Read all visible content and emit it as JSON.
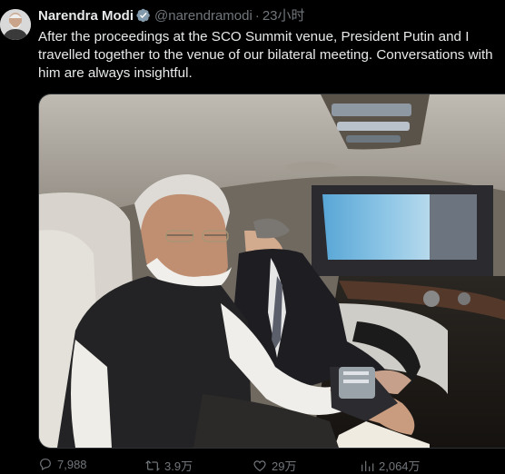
{
  "author": {
    "name": "Narendra Modi",
    "handle": "@narendramodi",
    "separator": "·",
    "time": "23小时"
  },
  "tweet": {
    "lines": [
      "After the proceedings at the SCO Summit venue, President Putin and I",
      "travelled together to the venue of our bilateral meeting. Conversations with",
      "him are always insightful."
    ]
  },
  "media": {
    "alt": "Photo inside a car"
  },
  "actions": {
    "replies": "7,988",
    "reposts": "3.9万",
    "likes": "29万",
    "views": "2,064万"
  },
  "colors": {
    "background": "#000000",
    "text": "#e7e9ea",
    "muted": "#71767b",
    "verified": "#1d9bf0"
  },
  "icons": [
    "verified-badge-icon",
    "reply-icon",
    "repost-icon",
    "like-icon",
    "views-icon"
  ]
}
